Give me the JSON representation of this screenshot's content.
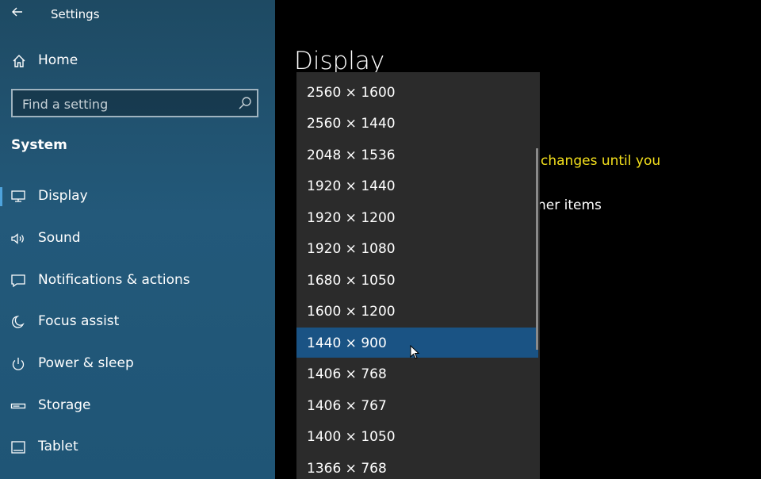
{
  "app": {
    "title": "Settings"
  },
  "sidebar": {
    "home_label": "Home",
    "search": {
      "placeholder": "Find a setting"
    },
    "section_label": "System",
    "items": [
      {
        "label": "Display",
        "icon": "monitor-icon",
        "selected": true
      },
      {
        "label": "Sound",
        "icon": "speaker-icon"
      },
      {
        "label": "Notifications & actions",
        "icon": "notification-icon"
      },
      {
        "label": "Focus assist",
        "icon": "moon-icon"
      },
      {
        "label": "Power & sleep",
        "icon": "power-icon"
      },
      {
        "label": "Storage",
        "icon": "storage-icon"
      },
      {
        "label": "Tablet",
        "icon": "tablet-icon"
      }
    ]
  },
  "main": {
    "title": "Display",
    "warning_fragment": "changes until you",
    "obscured_fragment": "ner items"
  },
  "dropdown": {
    "selected_value": "1440 × 900",
    "options": [
      "2560 × 1600",
      "2560 × 1440",
      "2048 × 1536",
      "1920 × 1440",
      "1920 × 1200",
      "1920 × 1080",
      "1680 × 1050",
      "1600 × 1200",
      "1440 × 900",
      "1406 × 768",
      "1406 × 767",
      "1400 × 1050",
      "1366 × 768"
    ]
  },
  "colors": {
    "sidebar_bg": "#23597a",
    "dropdown_bg": "#2b2b2b",
    "selected_option": "#1a5384",
    "accent": "#4ea3dc",
    "warning_text": "#f4e01c"
  }
}
